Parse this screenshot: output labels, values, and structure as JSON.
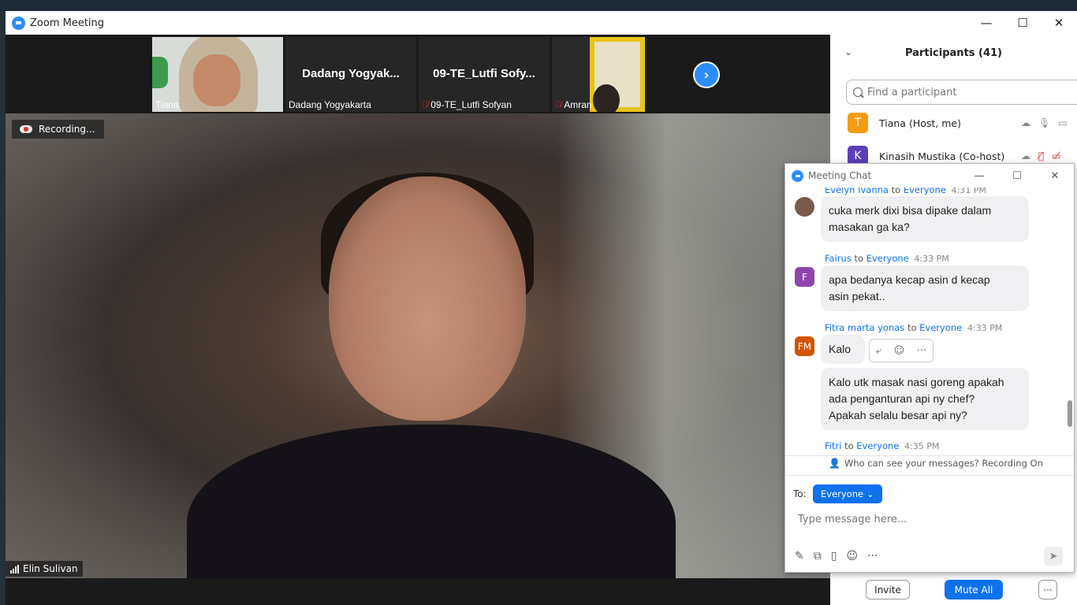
{
  "window": {
    "title": "Zoom Meeting",
    "controls": {
      "minimize": "—",
      "maximize": "☐",
      "close": "✕"
    }
  },
  "thumbnails": [
    {
      "label": "Tiana",
      "big_name": "",
      "muted": false
    },
    {
      "label": "Dadang Yogyakarta",
      "big_name": "Dadang  Yogyak...",
      "muted": false
    },
    {
      "label": "09-TE_Lutfi Sofyan",
      "big_name": "09-TE_Lutfi  Sofy...",
      "muted": true
    },
    {
      "label": "Amran",
      "big_name": "",
      "muted": true
    }
  ],
  "thumb_next_icon": "›",
  "recording": {
    "label": "Recording..."
  },
  "speaker": {
    "name": "Elin Sulivan"
  },
  "participants": {
    "title": "Participants (41)",
    "search_placeholder": "Find a participant",
    "list": [
      {
        "initial": "T",
        "name": "Tiana (Host, me)",
        "color": "#f39c12"
      },
      {
        "initial": "K",
        "name": "Kinasih Mustika (Co-host)",
        "color": "#5b3fb8"
      }
    ],
    "footer": {
      "invite": "Invite",
      "mute_all": "Mute All",
      "more": "···"
    }
  },
  "chat": {
    "title": "Meeting Chat",
    "messages": [
      {
        "sender": "Evelyn Ivanna",
        "to_word": "to",
        "recipient": "Everyone",
        "time": "4:31 PM",
        "text_lines": [
          "cuka merk dixi bisa dipake dalam",
          "masakan ga ka?"
        ]
      },
      {
        "sender": "Fairus",
        "to_word": "to",
        "recipient": "Everyone",
        "time": "4:33 PM",
        "initial": "F",
        "color": "#8e44ad",
        "text_lines": [
          "apa bedanya kecap asin   d kecap",
          "asin pekat.."
        ]
      },
      {
        "sender": "Fitra marta yonas",
        "to_word": "to",
        "recipient": "Everyone",
        "time": "4:33 PM",
        "initial": "FM",
        "color": "#d35400",
        "text_lines": [
          "Kalo"
        ]
      },
      {
        "text_lines": [
          "Kalo utk masak nasi goreng apakah",
          "ada penganturan api ny chef?",
          "Apakah selalu besar api ny?"
        ]
      },
      {
        "sender": "Fitri",
        "to_word": "to",
        "recipient": "Everyone",
        "time": "4:35 PM"
      }
    ],
    "notice": "Who can see your messages? Recording On",
    "to_label": "To:",
    "recipient_button": "Everyone",
    "input_placeholder": "Type message here...",
    "toolbar_more": "···"
  }
}
